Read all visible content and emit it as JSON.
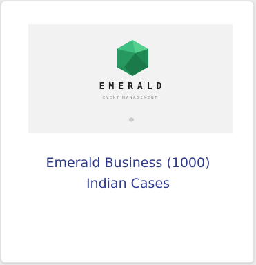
{
  "card": {
    "logo": {
      "wordmark": "EMERALD",
      "tagline": "EVENT MANAGEMENT",
      "icon": "emerald-gem-icon"
    },
    "title_line1": "Emerald Business (1000)",
    "title_line2": "Indian Cases"
  },
  "colors": {
    "title": "#2e3a8c",
    "gem_light": "#3fbf7f",
    "gem_dark": "#1f8a55",
    "thumb_background": "#f2f2f2"
  }
}
